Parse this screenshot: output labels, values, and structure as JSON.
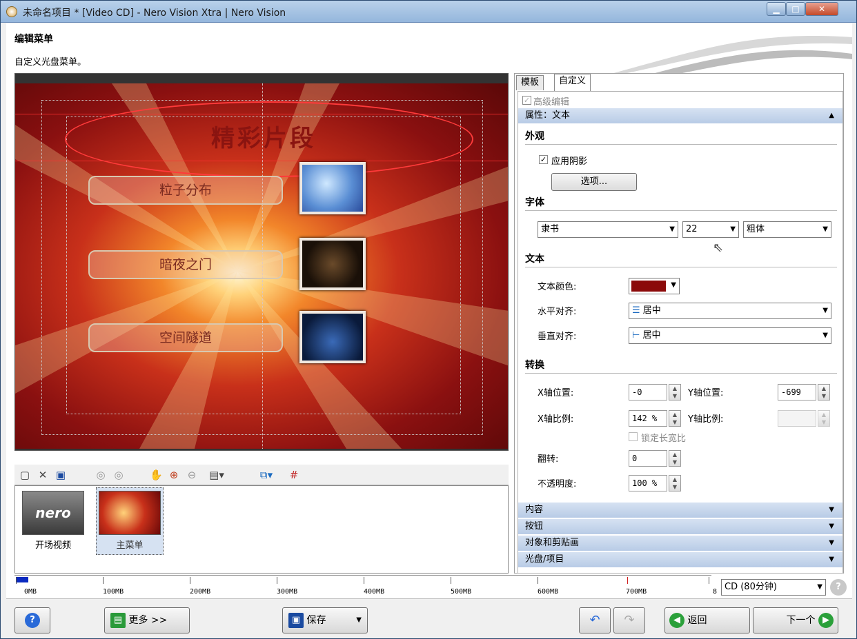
{
  "window": {
    "title": "未命名项目 * [Video CD] - Nero Vision Xtra | Nero Vision"
  },
  "header": {
    "title": "编辑菜单",
    "subtitle": "自定义光盘菜单。"
  },
  "preview": {
    "menu_title": "精彩片段",
    "buttons": [
      "粒子分布",
      "暗夜之门",
      "空间隧道"
    ]
  },
  "strip": {
    "items": [
      {
        "label": "开场视频",
        "logo": "nero"
      },
      {
        "label": "主菜单"
      }
    ]
  },
  "right_panel": {
    "tabs": [
      "模板",
      "自定义"
    ],
    "active_tab": "自定义",
    "advanced_edit": "高级编辑",
    "section_title": "属性：文本",
    "appearance": {
      "heading": "外观",
      "apply_shadow": "应用阴影",
      "options_button": "选项..."
    },
    "font": {
      "heading": "字体",
      "family": "隶书",
      "size": "22",
      "style": "粗体"
    },
    "text": {
      "heading": "文本",
      "color_label": "文本颜色:",
      "color_value": "#8b0a0a",
      "halign_label": "水平对齐:",
      "halign_value": "居中",
      "valign_label": "垂直对齐:",
      "valign_value": "居中"
    },
    "transform": {
      "heading": "转换",
      "x_pos_label": "X轴位置:",
      "x_pos": "-0",
      "y_pos_label": "Y轴位置:",
      "y_pos": "-699",
      "x_scale_label": "X轴比例:",
      "x_scale": "142 %",
      "y_scale_label": "Y轴比例:",
      "y_scale": "",
      "lock_ratio": "锁定长宽比",
      "flip_label": "翻转:",
      "flip": "0",
      "opacity_label": "不透明度:",
      "opacity": "100 %"
    },
    "collapsed_sections": [
      "内容",
      "按钮",
      "对象和剪贴画",
      "光盘/项目"
    ]
  },
  "ruler": {
    "ticks": [
      "0MB",
      "100MB",
      "200MB",
      "300MB",
      "400MB",
      "500MB",
      "600MB",
      "700MB",
      "8"
    ],
    "disc_type": "CD (80分钟)"
  },
  "bottom_bar": {
    "more_label": "更多 >>",
    "save_label": "保存",
    "back_label": "返回",
    "next_label": "下一个"
  }
}
